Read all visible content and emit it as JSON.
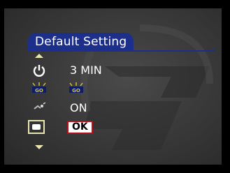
{
  "menu": {
    "title": "Default Setting",
    "rows": [
      {
        "icon": "power-icon",
        "value": "3 MIN"
      },
      {
        "icon": "lcd-brightness-icon",
        "value": ""
      },
      {
        "icon": "sound-icon",
        "value": "ON"
      },
      {
        "icon": "video-mode-icon",
        "value": "OK"
      }
    ]
  },
  "colors": {
    "title_bg": "#1c2f8a",
    "highlight": "#e8e6b0",
    "ok_border": "#b8101a"
  }
}
